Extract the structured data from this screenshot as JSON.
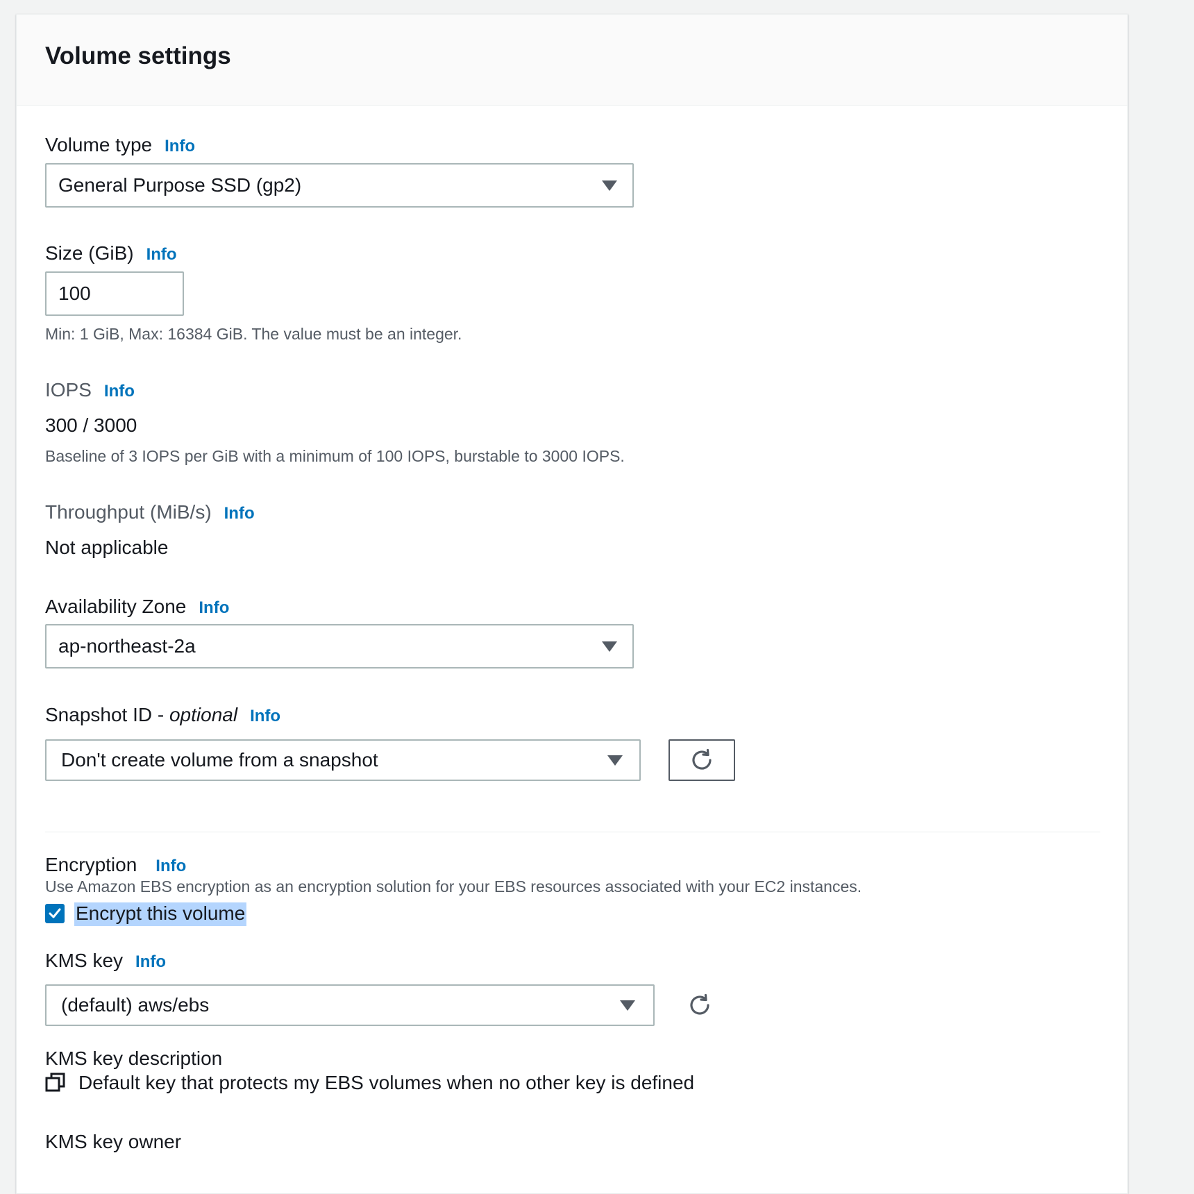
{
  "panel": {
    "title": "Volume settings"
  },
  "info_label": "Info",
  "volume_type": {
    "label": "Volume type",
    "selected": "General Purpose SSD (gp2)"
  },
  "size": {
    "label": "Size (GiB)",
    "value": "100",
    "hint": "Min: 1 GiB, Max: 16384 GiB. The value must be an integer."
  },
  "iops": {
    "label": "IOPS",
    "value": "300 / 3000",
    "hint": "Baseline of 3 IOPS per GiB with a minimum of 100 IOPS, burstable to 3000 IOPS."
  },
  "throughput": {
    "label": "Throughput (MiB/s)",
    "value": "Not applicable"
  },
  "availability_zone": {
    "label": "Availability Zone",
    "selected": "ap-northeast-2a"
  },
  "snapshot": {
    "label": "Snapshot ID - ",
    "label_optional": "optional",
    "selected": "Don't create volume from a snapshot",
    "refresh_icon": "refresh-icon"
  },
  "encryption": {
    "label": "Encryption",
    "description": "Use Amazon EBS encryption as an encryption solution for your EBS resources associated with your EC2 instances.",
    "checkbox_label": "Encrypt this volume",
    "checked": true
  },
  "kms_key": {
    "label": "KMS key",
    "selected": "(default) aws/ebs",
    "refresh_icon": "refresh-icon"
  },
  "kms_description": {
    "label": "KMS key description",
    "value": "Default key that protects my EBS volumes when no other key is defined",
    "icon": "copy-icon"
  },
  "kms_owner": {
    "label": "KMS key owner"
  },
  "colors": {
    "info_link": "#0073bb",
    "checkbox": "#0073bb",
    "selection_highlight": "#b4d5fe"
  }
}
